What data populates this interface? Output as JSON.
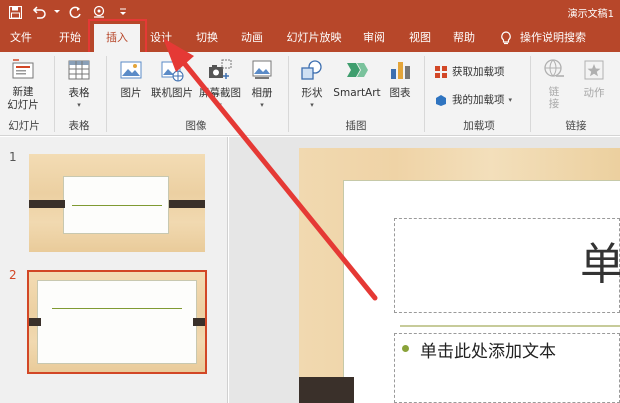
{
  "window": {
    "doc_title": "演示文稿1"
  },
  "qat": {
    "save_icon": "save-icon",
    "undo_icon": "undo-icon",
    "redo_icon": "redo-icon",
    "present_icon": "present-icon",
    "customize_icon": "customize-qat-icon"
  },
  "tabs": [
    {
      "label": "文件"
    },
    {
      "label": "开始"
    },
    {
      "label": "插入"
    },
    {
      "label": "设计"
    },
    {
      "label": "切换"
    },
    {
      "label": "动画"
    },
    {
      "label": "幻灯片放映"
    },
    {
      "label": "审阅"
    },
    {
      "label": "视图"
    },
    {
      "label": "帮助"
    }
  ],
  "tell_me": "操作说明搜索",
  "ribbon": {
    "new_slide": "新建\n幻灯片",
    "table": "表格",
    "pictures": "图片",
    "online_pictures": "联机图片",
    "screenshot": "屏幕截图",
    "album": "相册",
    "shapes": "形状",
    "smartart": "SmartArt",
    "chart": "图表",
    "get_addins": "获取加载项",
    "my_addins": "我的加载项",
    "link": "链\n接",
    "action": "动作",
    "groups": {
      "slides": "幻灯片",
      "tables": "表格",
      "images": "图像",
      "illustrations": "插图",
      "addins": "加载项",
      "links": "链接"
    }
  },
  "thumbnails": [
    {
      "number": "1"
    },
    {
      "number": "2"
    }
  ],
  "slide": {
    "title_visible": "单",
    "body_placeholder": "单击此处添加文本"
  },
  "colors": {
    "accent": "#b7472a",
    "highlight": "#e53935",
    "selection": "#d24726"
  }
}
